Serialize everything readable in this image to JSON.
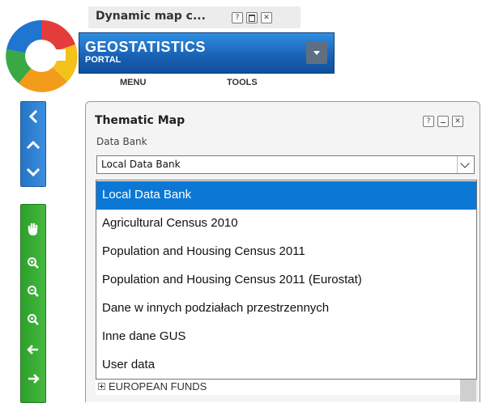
{
  "dynamic_map": {
    "title": "Dynamic map c..."
  },
  "header": {
    "title": "GEOSTATISTICS",
    "subtitle": "PORTAL",
    "menu_label": "MENU",
    "tools_label": "TOOLS"
  },
  "panel": {
    "title": "Thematic Map",
    "data_bank_label": "Data Bank",
    "selected_value": "Local Data Bank"
  },
  "dropdown": {
    "options": [
      "Local Data Bank",
      "Agricultural Census 2010",
      "Population and Housing Census 2011",
      "Population and Housing Census 2011 (Eurostat)",
      "Dane w innych podziałach przestrzennych",
      "Inne dane GUS",
      "User data"
    ],
    "selected_index": 0
  },
  "tree": {
    "item_label": "EUROPEAN FUNDS"
  },
  "colors": {
    "brand_blue": "#1a63b8",
    "toolbar_green": "#2ea02c",
    "selection_blue": "#0b78d6"
  },
  "icons": {
    "blue_toolbar": [
      "chevron-left-icon",
      "chevron-up-icon",
      "chevron-down-icon"
    ],
    "green_toolbar": [
      "hand-icon",
      "zoom-in-icon",
      "zoom-out-icon",
      "zoom-extent-icon",
      "arrow-left-icon",
      "arrow-right-icon"
    ]
  }
}
